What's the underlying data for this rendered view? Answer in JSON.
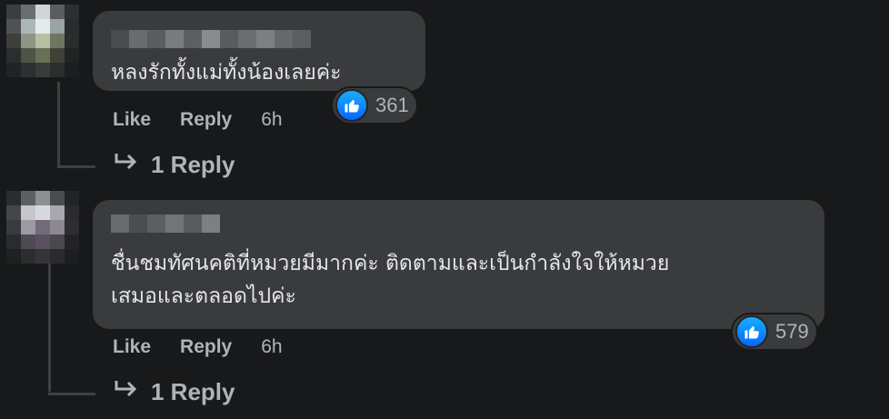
{
  "comments": [
    {
      "author": "",
      "text_lines": [
        "หลงรักทั้งแม่ทั้งน้องเลยค่ะ"
      ],
      "reaction_count": "361",
      "actions": {
        "like": "Like",
        "reply": "Reply",
        "time": "6h"
      },
      "replies_label": "1 Reply"
    },
    {
      "author": "",
      "text_lines": [
        "ชื่นชมทัศนคติที่หมวยมีมากค่ะ ติดตามและเป็นกำลังใจให้หมวย",
        "เสมอและตลอดไปค่ะ"
      ],
      "reaction_count": "579",
      "actions": {
        "like": "Like",
        "reply": "Reply",
        "time": "6h"
      },
      "replies_label": "1 Reply"
    }
  ],
  "icons": {
    "reaction": "like-thumb-icon",
    "reply": "reply-arrow-icon"
  },
  "colors": {
    "background": "#18191a",
    "bubble": "#3a3b3c",
    "accent": "#0866ff",
    "muted_text": "#b0b3b8"
  }
}
